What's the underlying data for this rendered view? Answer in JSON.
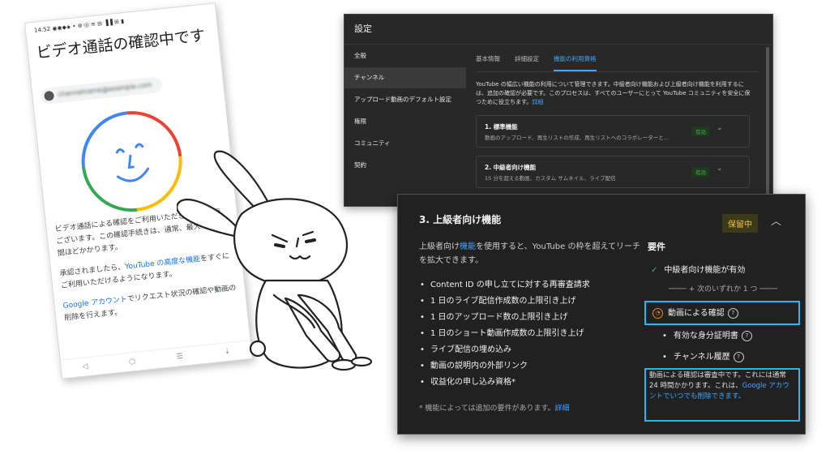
{
  "phone": {
    "status": "14:52 ◉◉◆◈ • ⊗ ◎ ≋ ⊞ ▐▐ ⊞ ▮",
    "title": "ビデオ通話の確認中です",
    "account_chip": "channelname@example.com",
    "message1": "ビデオ通話による確認をご利用いただきありがとうございます。この確認手続きは、通常、最大で 24 時間ほどかかります。",
    "message2_pre": "承認されましたら、",
    "message2_link": "YouTube の高度な機能",
    "message2_post": "をすぐにご利用いただけるようになります。",
    "message3_link": "Google アカウント",
    "message3_post": "でリクエスト状況の確認や動画の削除を行えます。",
    "nav": [
      "◁",
      "○",
      "☰",
      "⇣"
    ]
  },
  "settings": {
    "title": "設定",
    "sidebar": [
      {
        "label": "全般"
      },
      {
        "label": "チャンネル",
        "active": true
      },
      {
        "label": "アップロード動画のデフォルト設定"
      },
      {
        "label": "権限"
      },
      {
        "label": "コミュニティ"
      },
      {
        "label": "契約"
      }
    ],
    "tabs": [
      "基本情報",
      "詳細設定",
      "機能の利用資格"
    ],
    "description": "YouTube の幅広い機能の利用について管理できます。中級者向け機能および上級者向け機能を利用するには、追加の確認が必要です。このプロセスは、すべてのユーザーにとって YouTube コミュニティを安全に保つために役立ちます。",
    "description_link": "詳細",
    "cards": [
      {
        "title": "1. 標準機能",
        "subtitle": "動画のアップロード、再生リストの作成、再生リストへのコラボレーターと...",
        "status": "有効"
      },
      {
        "title": "2. 中級者向け機能",
        "subtitle": "15 分を超える動画、カスタム サムネイル、ライブ配信",
        "status": "有効"
      }
    ]
  },
  "advanced": {
    "title": "3. 上級者向け機能",
    "badge": "保留中",
    "intro_pre": "上級者向け",
    "intro_link": "機能",
    "intro_post": "を使用すると、YouTube の枠を超えてリーチを拡大できます。",
    "features": [
      "Content ID の申し立てに対する再審査請求",
      "1 日のライブ配信作成数の上限引き上げ",
      "1 日のアップロード数の上限引き上げ",
      "1 日のショート動画作成数の上限引き上げ",
      "ライブ配信の埋め込み",
      "動画の説明内の外部リンク",
      "収益化の申し込み資格*"
    ],
    "note": "* 機能によっては追加の要件があります。",
    "note_link": "詳細",
    "requirements": {
      "title": "要件",
      "met": "中級者向け機能が有効",
      "any_one": "+ 次のいずれか 1 つ",
      "options": [
        "動画による確認",
        "有効な身分証明書",
        "チャンネル履歴"
      ],
      "status_text": "動画による確認は審査中です。これには通常 24 時間かかります。これは、",
      "status_link": "Google アカウントでいつでも削除できます。"
    }
  },
  "colors": {
    "accent_link": "#3ea6ff",
    "highlight": "#29b6f6",
    "pending": "#f4c542",
    "enabled": "#4caf50"
  }
}
